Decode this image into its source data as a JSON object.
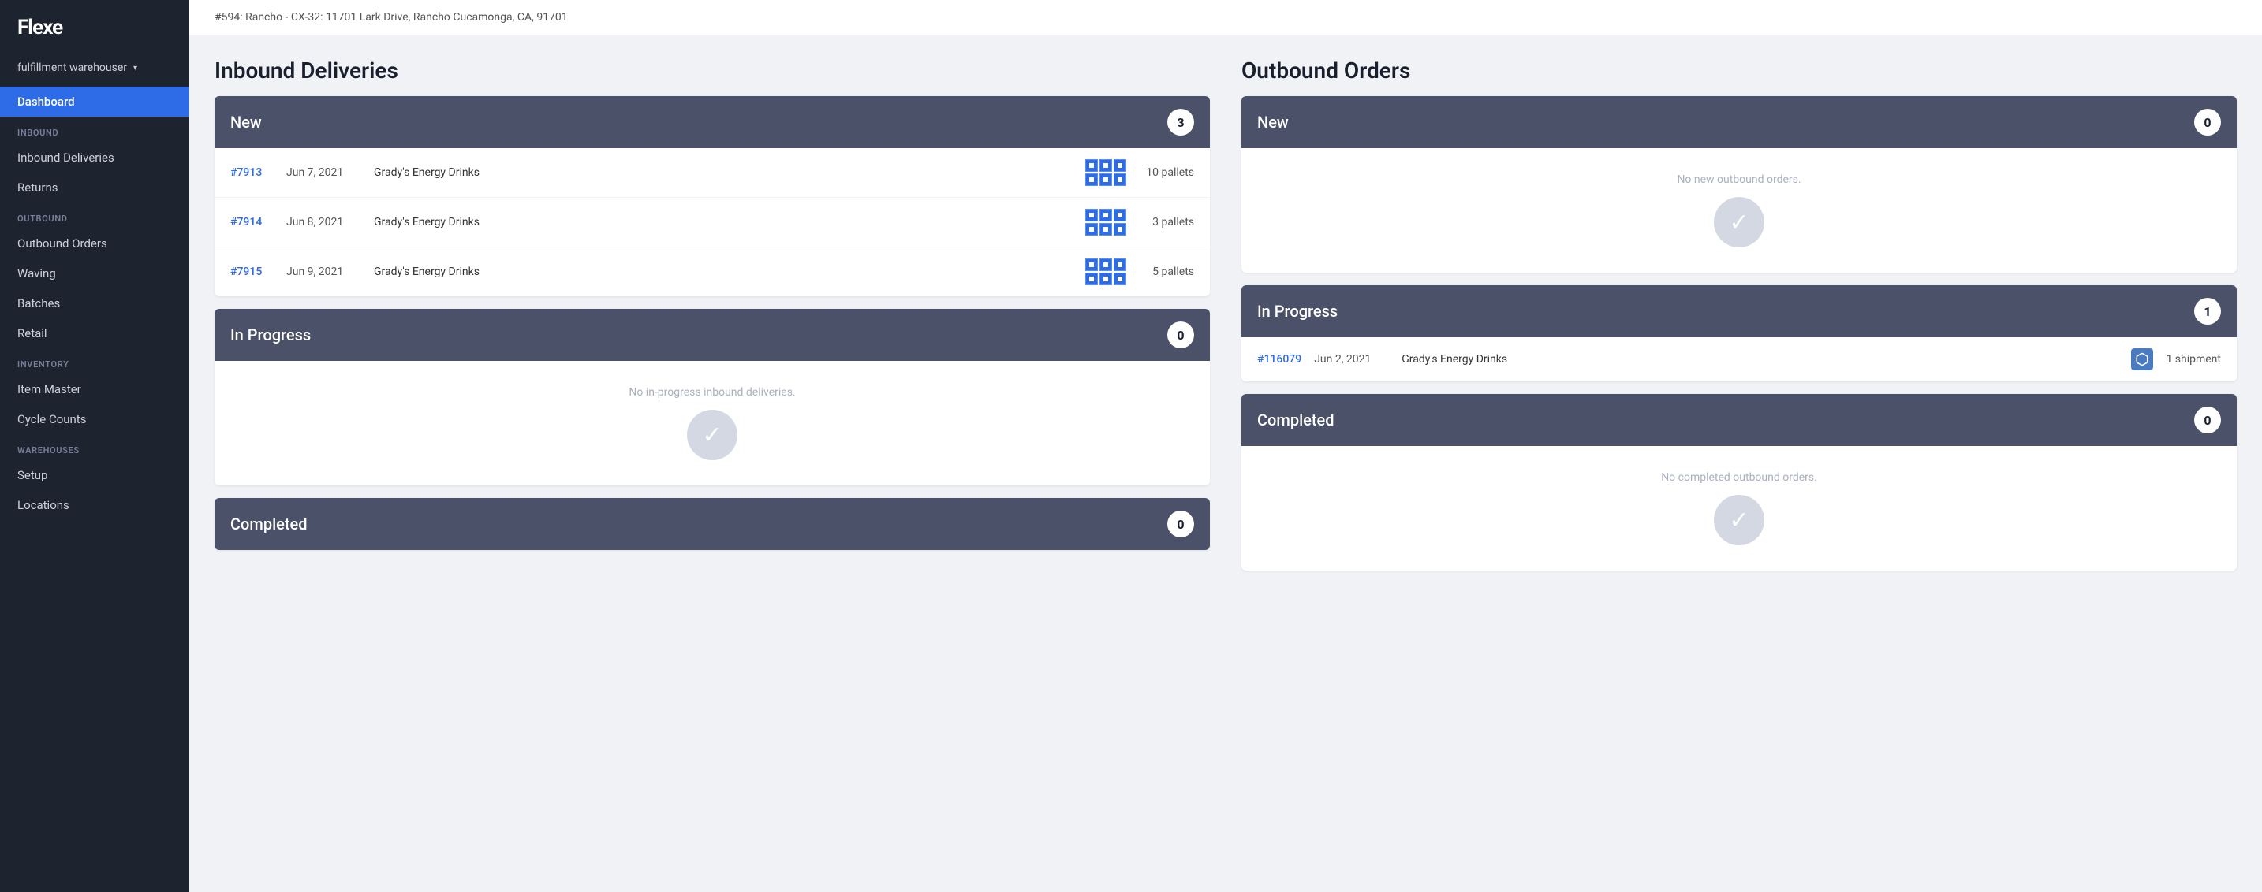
{
  "sidebar": {
    "logo": "Flexe",
    "account": "fulfillment warehouser",
    "sections": [
      {
        "label": "",
        "items": [
          {
            "id": "dashboard",
            "text": "Dashboard",
            "active": true
          }
        ]
      },
      {
        "label": "INBOUND",
        "items": [
          {
            "id": "inbound-deliveries",
            "text": "Inbound Deliveries",
            "active": false
          },
          {
            "id": "returns",
            "text": "Returns",
            "active": false
          }
        ]
      },
      {
        "label": "OUTBOUND",
        "items": [
          {
            "id": "outbound-orders",
            "text": "Outbound Orders",
            "active": false
          },
          {
            "id": "waving",
            "text": "Waving",
            "active": false
          },
          {
            "id": "batches",
            "text": "Batches",
            "active": false
          },
          {
            "id": "retail",
            "text": "Retail",
            "active": false
          }
        ]
      },
      {
        "label": "INVENTORY",
        "items": [
          {
            "id": "item-master",
            "text": "Item Master",
            "active": false
          },
          {
            "id": "cycle-counts",
            "text": "Cycle Counts",
            "active": false
          }
        ]
      },
      {
        "label": "WAREHOUSES",
        "items": [
          {
            "id": "setup",
            "text": "Setup",
            "active": false
          },
          {
            "id": "locations",
            "text": "Locations",
            "active": false
          }
        ]
      }
    ]
  },
  "topbar": {
    "breadcrumb": "#594: Rancho - CX-32: 11701 Lark Drive, Rancho Cucamonga, CA, 91701"
  },
  "inbound": {
    "title": "Inbound Deliveries",
    "new_label": "New",
    "new_count": "3",
    "new_orders": [
      {
        "id": "#7913",
        "date": "Jun 7, 2021",
        "customer": "Grady's Energy Drinks",
        "quantity": "10 pallets"
      },
      {
        "id": "#7914",
        "date": "Jun 8, 2021",
        "customer": "Grady's Energy Drinks",
        "quantity": "3 pallets"
      },
      {
        "id": "#7915",
        "date": "Jun 9, 2021",
        "customer": "Grady's Energy Drinks",
        "quantity": "5 pallets"
      }
    ],
    "in_progress_label": "In Progress",
    "in_progress_count": "0",
    "in_progress_empty": "No in-progress inbound deliveries.",
    "completed_label": "Completed",
    "completed_count": "0"
  },
  "outbound": {
    "title": "Outbound Orders",
    "new_label": "New",
    "new_count": "0",
    "new_empty": "No new outbound orders.",
    "in_progress_label": "In Progress",
    "in_progress_count": "1",
    "in_progress_orders": [
      {
        "id": "#116079",
        "date": "Jun 2, 2021",
        "customer": "Grady's Energy Drinks",
        "quantity": "1 shipment"
      }
    ],
    "completed_label": "Completed",
    "completed_count": "0",
    "completed_empty": "No completed outbound orders."
  }
}
